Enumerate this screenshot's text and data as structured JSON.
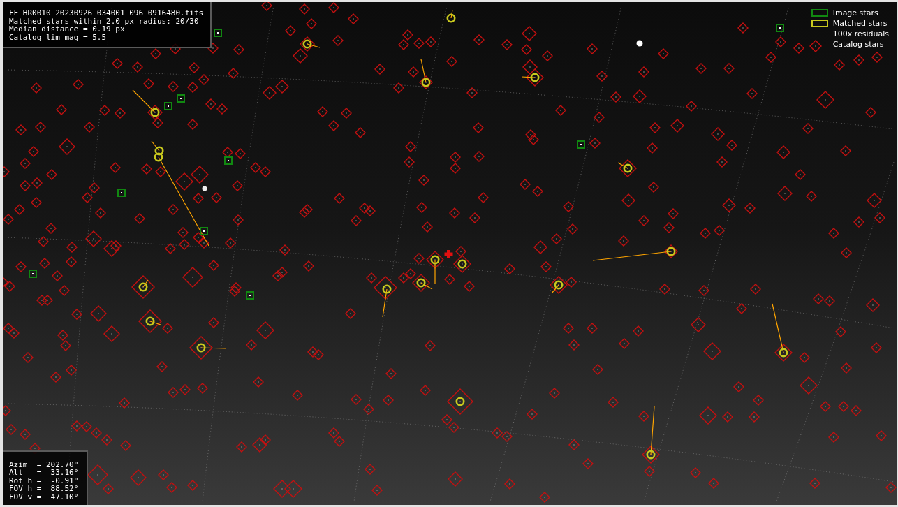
{
  "info_panel": {
    "lines": [
      "FF_HR0010_20230926_034001_096_0916480.fits",
      "Matched stars within 2.0 px radius: 20/30",
      "Median distance = 0.19 px",
      "Catalog lim mag = 5.5"
    ]
  },
  "legend": [
    {
      "kind": "box",
      "label": "Image stars",
      "color": "#118811"
    },
    {
      "kind": "box",
      "label": "Matched stars",
      "color": "#c8c81e"
    },
    {
      "kind": "line",
      "label": "100x residuals",
      "color": "#ffa500"
    },
    {
      "kind": "none",
      "label": "Catalog stars"
    }
  ],
  "pointing_panel": {
    "lines": [
      "Azim  = 202.70°",
      "Alt   =  33.16°",
      "Rot h =  -0.91°",
      "FOV h =  88.52°",
      "FOV v =  47.10°"
    ]
  }
}
